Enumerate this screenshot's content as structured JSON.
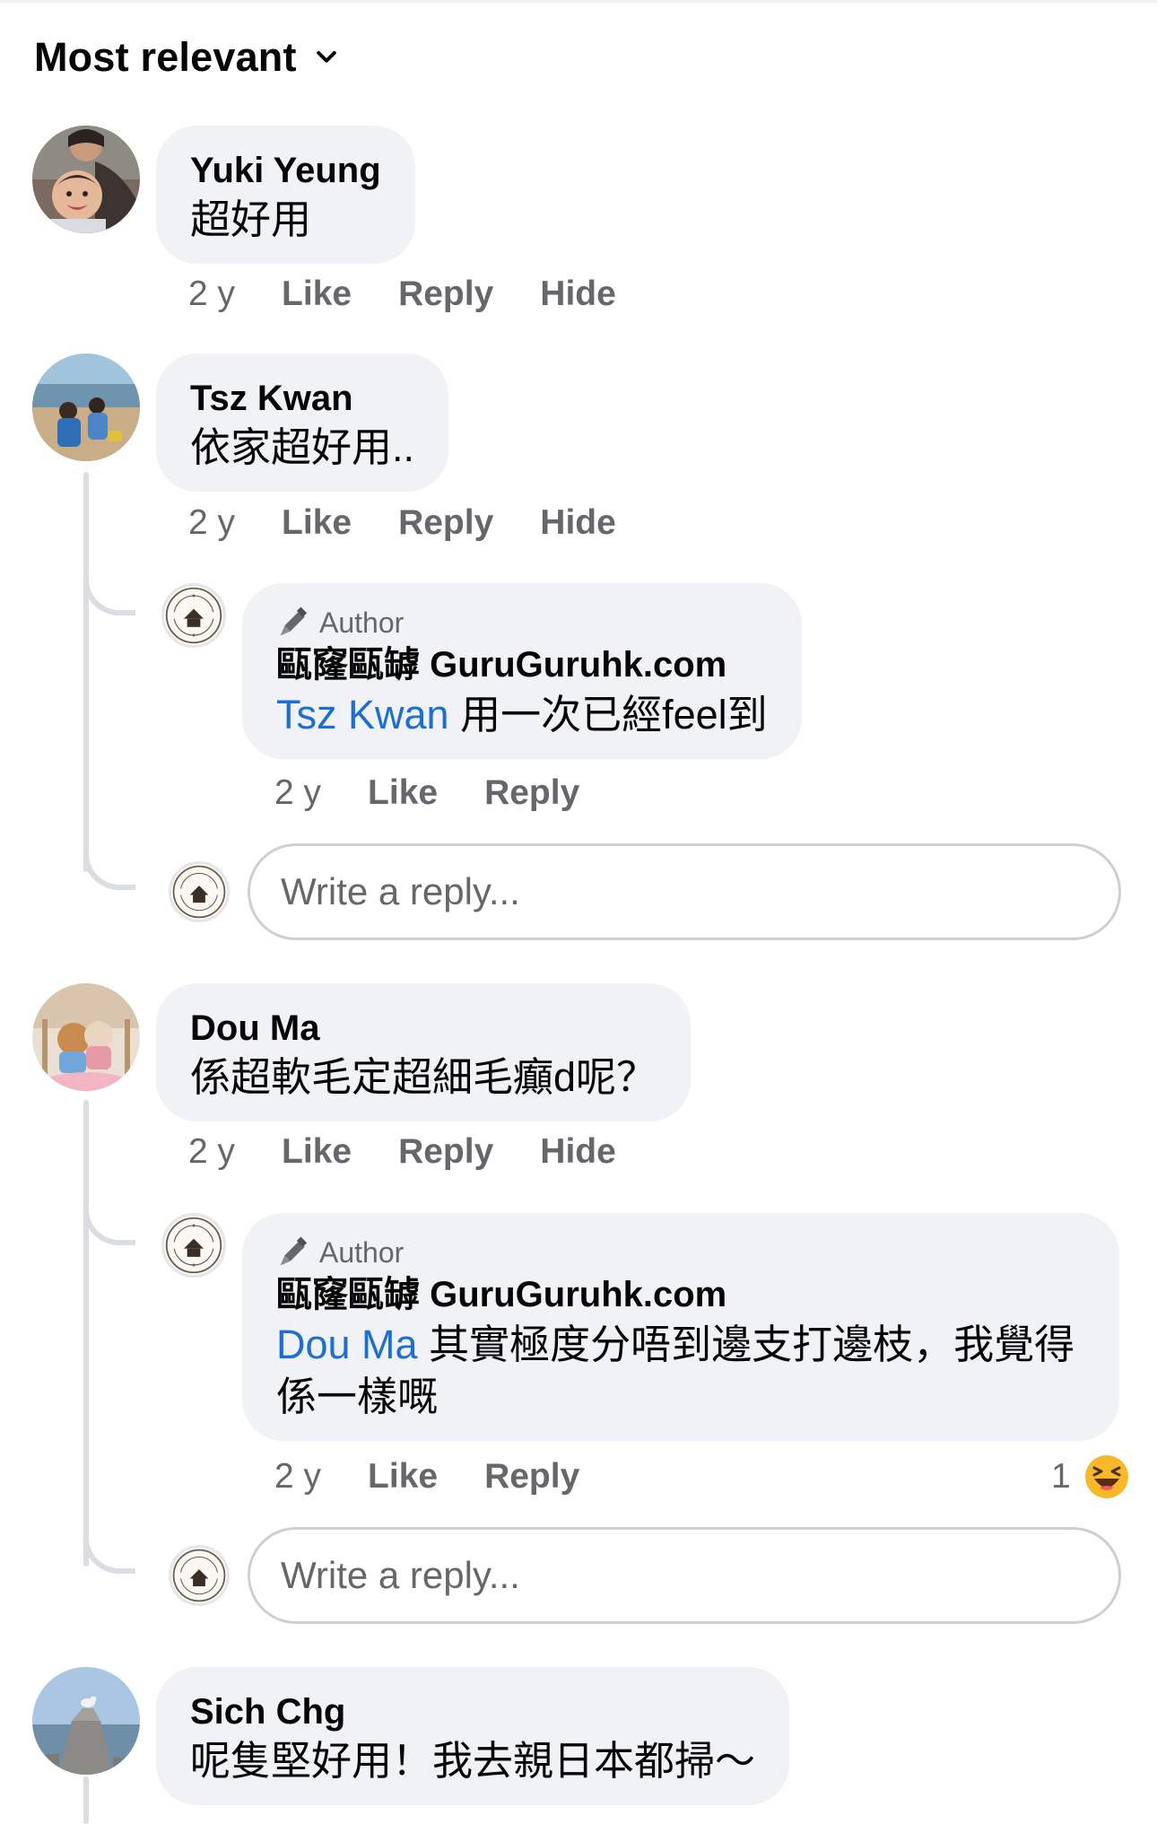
{
  "sort": {
    "label": "Most relevant",
    "icon": "chevron-down-icon"
  },
  "labels": {
    "like": "Like",
    "reply": "Reply",
    "hide": "Hide",
    "author_badge": "Author",
    "reply_placeholder": "Write a reply..."
  },
  "comments": [
    {
      "author": "Yuki Yeung",
      "text": "超好用",
      "time": "2 y"
    },
    {
      "author": "Tsz Kwan",
      "text": "依家超好用..",
      "time": "2 y",
      "reply": {
        "page": "甌窿甌罅 GuruGuruhk.com",
        "mention": "Tsz Kwan",
        "text": " 用一次已經feel到",
        "time": "2 y"
      }
    },
    {
      "author": "Dou Ma",
      "text": "係超軟毛定超細毛癲d呢？",
      "time": "2 y",
      "reply": {
        "page": "甌窿甌罅 GuruGuruhk.com",
        "mention": "Dou Ma",
        "text": " 其實極度分唔到邊支打邊枝，我覺得係一樣嘅",
        "time": "2 y",
        "reaction_count": "1",
        "reaction_icon": "haha-emoji-icon"
      }
    },
    {
      "author": "Sich Chg",
      "text": "呢隻堅好用！我去親日本都掃～"
    }
  ],
  "colors": {
    "mention": "#1a6ed8",
    "bubble": "#f0f2f5",
    "meta": "#65676b"
  }
}
